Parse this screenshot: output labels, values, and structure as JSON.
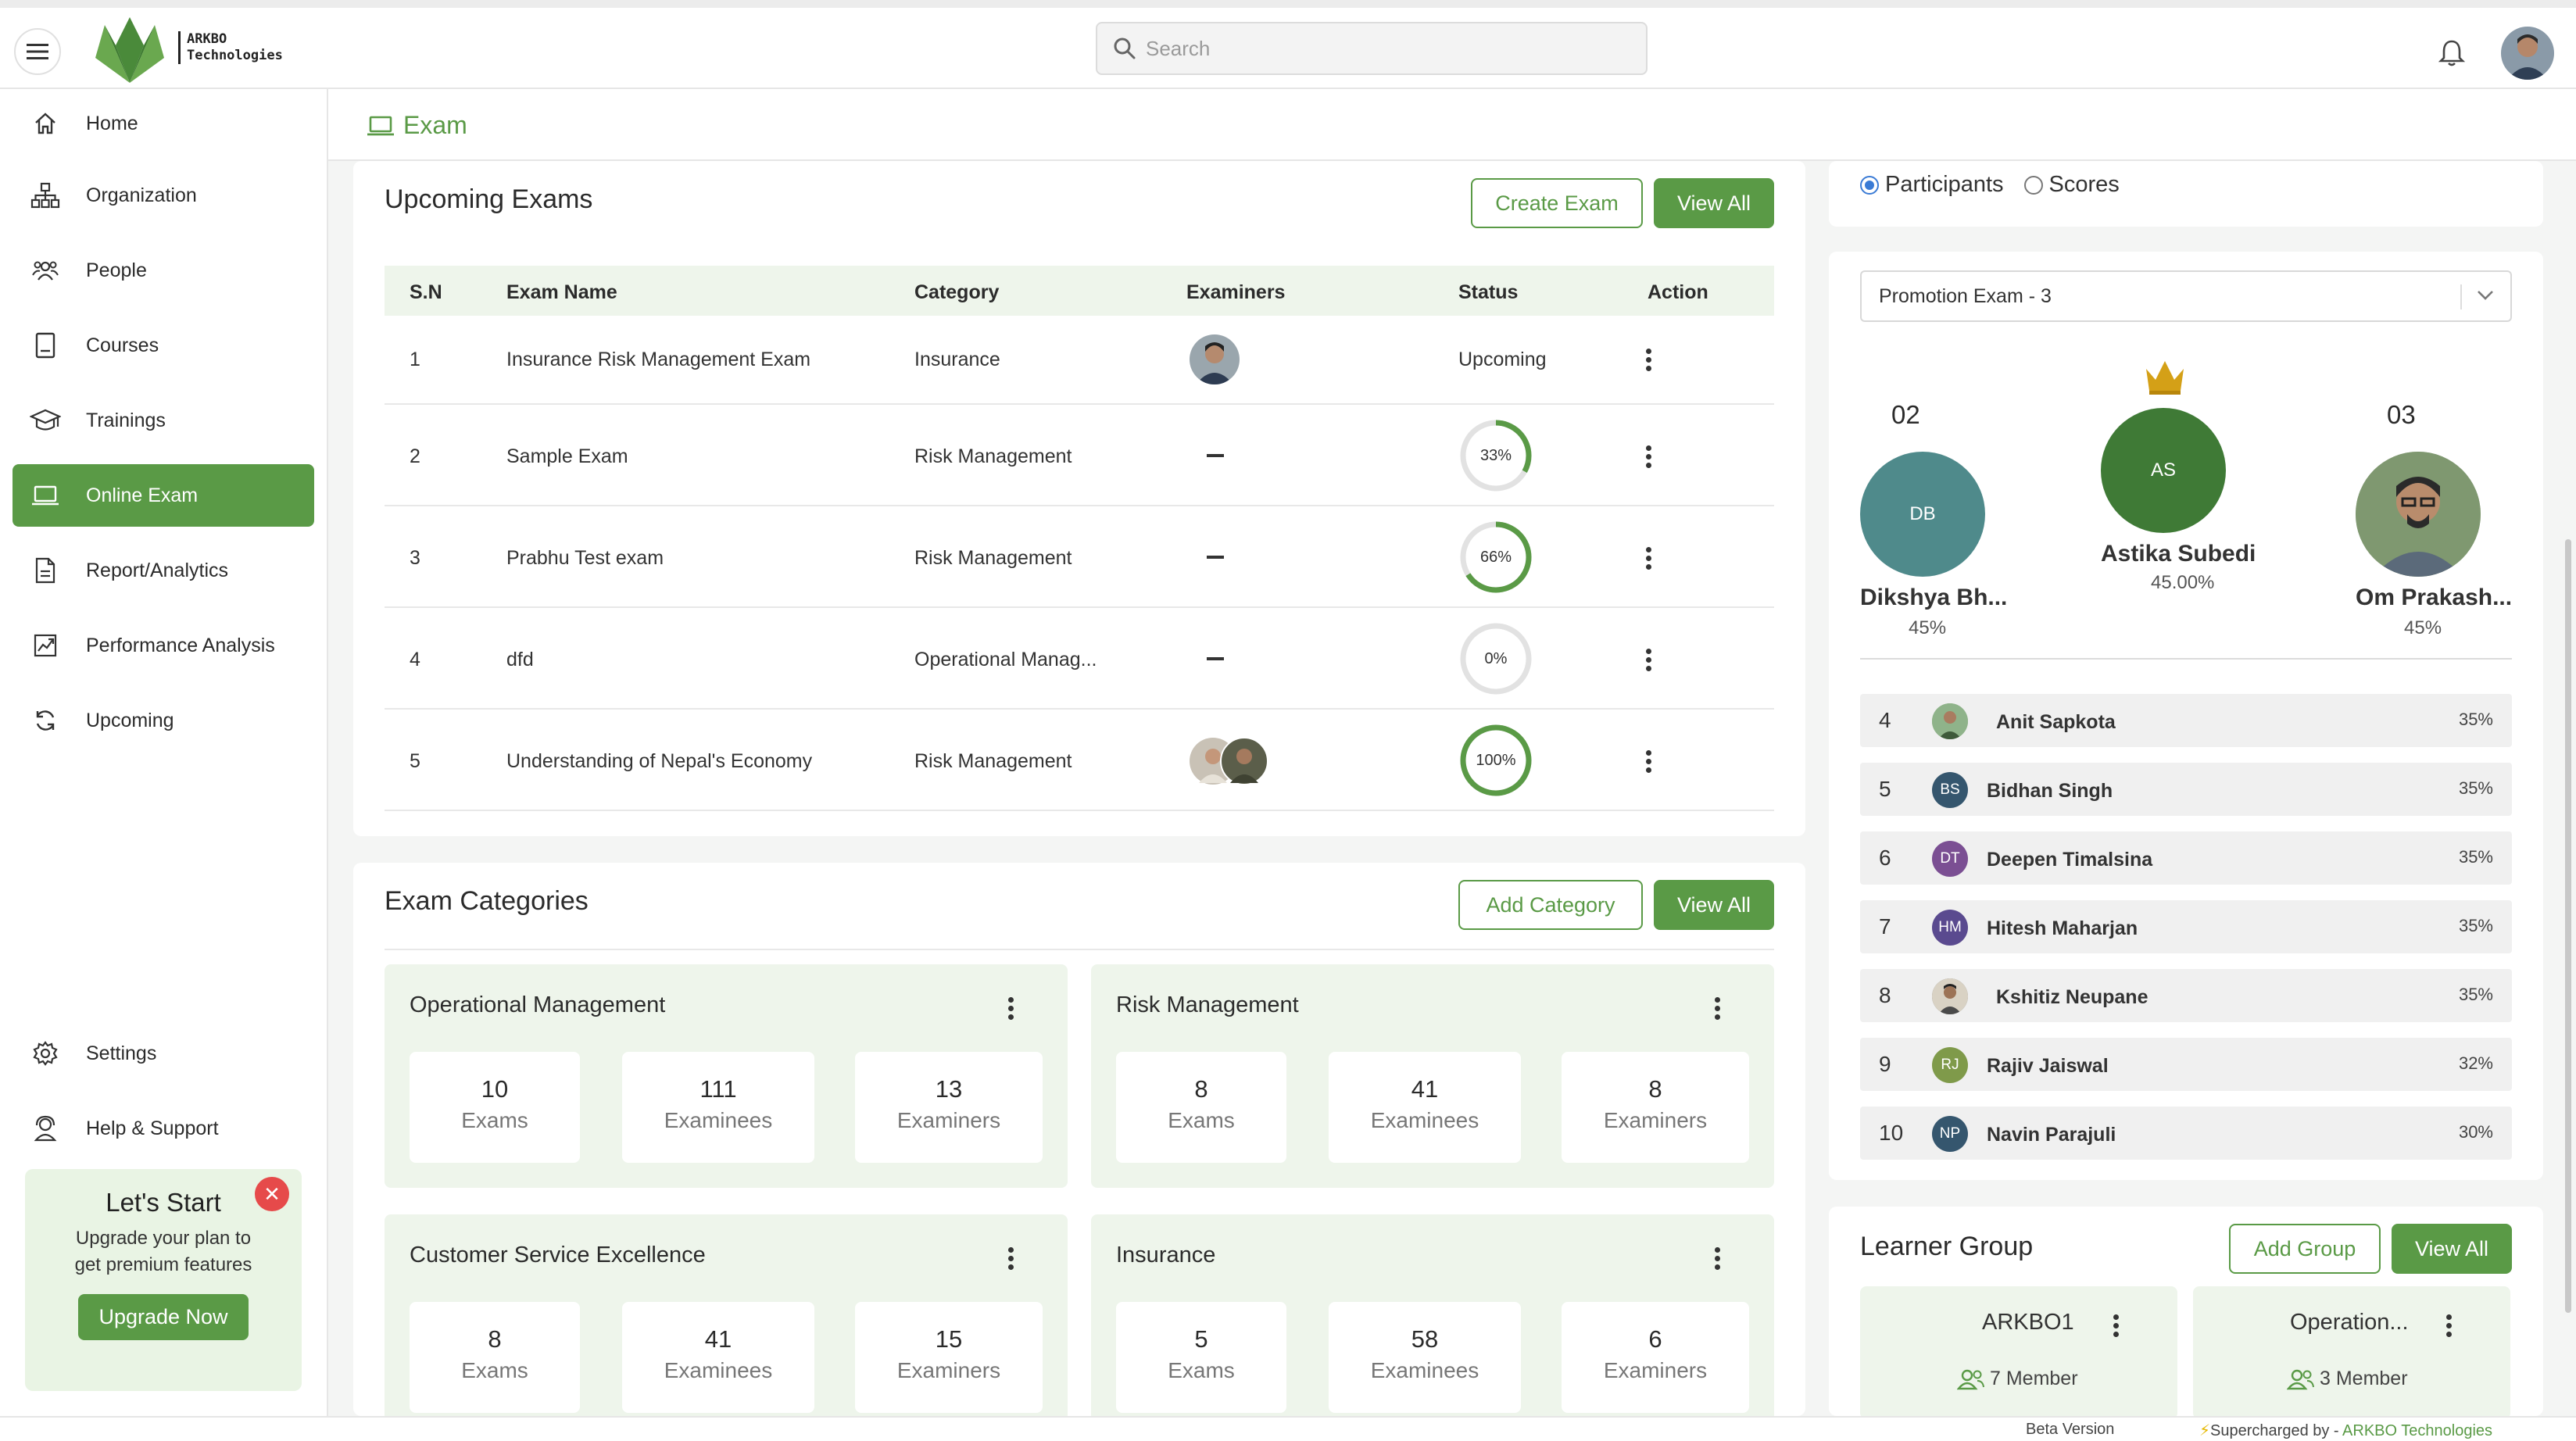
{
  "brand": {
    "logo_text_line1": "ARKBO",
    "logo_text_line2": "Technologies",
    "accent": "#5a9a46"
  },
  "search": {
    "placeholder": "Search"
  },
  "sidebar": {
    "items": [
      {
        "label": "Home",
        "icon": "home-icon"
      },
      {
        "label": "Organization",
        "icon": "org-chart-icon"
      },
      {
        "label": "People",
        "icon": "people-icon"
      },
      {
        "label": "Courses",
        "icon": "book-icon"
      },
      {
        "label": "Trainings",
        "icon": "graduation-cap-icon"
      },
      {
        "label": "Online Exam",
        "icon": "laptop-icon",
        "active": true
      },
      {
        "label": "Report/Analytics",
        "icon": "report-icon"
      },
      {
        "label": "Performance Analysis",
        "icon": "chart-icon"
      },
      {
        "label": "Upcoming",
        "icon": "refresh-icon"
      }
    ],
    "bottom_items": [
      {
        "label": "Settings",
        "icon": "gear-icon"
      },
      {
        "label": "Help & Support",
        "icon": "support-icon"
      }
    ],
    "upgrade": {
      "title": "Let's Start",
      "text_line1": "Upgrade your plan to",
      "text_line2": "get premium features",
      "button": "Upgrade Now"
    }
  },
  "page": {
    "title": "Exam"
  },
  "upcoming": {
    "title": "Upcoming Exams",
    "create_button": "Create Exam",
    "view_all": "View All",
    "columns": [
      "S.N",
      "Exam Name",
      "Category",
      "Examiners",
      "Status",
      "Action"
    ],
    "rows": [
      {
        "sn": "1",
        "name": "Insurance Risk Management Exam",
        "category": "Insurance",
        "examiners": "avatar",
        "status": "Upcoming",
        "progress": null
      },
      {
        "sn": "2",
        "name": "Sample Exam",
        "category": "Risk Management",
        "examiners": "none",
        "status": "33%",
        "progress": 33
      },
      {
        "sn": "3",
        "name": "Prabhu Test exam",
        "category": "Risk Management",
        "examiners": "none",
        "status": "66%",
        "progress": 66
      },
      {
        "sn": "4",
        "name": "dfd",
        "category": "Operational Manag...",
        "examiners": "none",
        "status": "0%",
        "progress": 0
      },
      {
        "sn": "5",
        "name": "Understanding of Nepal's Economy",
        "category": "Risk Management",
        "examiners": "avatars",
        "status": "100%",
        "progress": 100
      }
    ]
  },
  "categories": {
    "title": "Exam Categories",
    "add_button": "Add Category",
    "view_all": "View All",
    "items": [
      {
        "name": "Operational Management",
        "exams": "10",
        "examinees": "111",
        "examiners": "13"
      },
      {
        "name": "Risk Management",
        "exams": "8",
        "examinees": "41",
        "examiners": "8"
      },
      {
        "name": "Customer Service Excellence",
        "exams": "8",
        "examinees": "41",
        "examiners": "15"
      },
      {
        "name": "Insurance",
        "exams": "5",
        "examinees": "58",
        "examiners": "6"
      }
    ],
    "labels": {
      "exams": "Exams",
      "examinees": "Examinees",
      "examiners": "Examiners"
    }
  },
  "leaderboard": {
    "radio_participants": "Participants",
    "radio_scores": "Scores",
    "selected_exam": "Promotion Exam - 3",
    "podium": {
      "first": {
        "initials": "AS",
        "name": "Astika Subedi",
        "pct": "45.00%",
        "color": "#3f7a36"
      },
      "second": {
        "rank": "02",
        "initials": "DB",
        "name": "Dikshya Bh...",
        "pct": "45%",
        "color": "#4f8a8b"
      },
      "third": {
        "rank": "03",
        "name": "Om Prakash...",
        "pct": "45%"
      }
    },
    "rows": [
      {
        "rank": "4",
        "initials": "",
        "photo": true,
        "name": "Anit Sapkota",
        "pct": "35%",
        "color": "#8fb38a"
      },
      {
        "rank": "5",
        "initials": "BS",
        "photo": false,
        "name": "Bidhan Singh",
        "pct": "35%",
        "color": "#35566e"
      },
      {
        "rank": "6",
        "initials": "DT",
        "photo": false,
        "name": "Deepen Timalsina",
        "pct": "35%",
        "color": "#7b4f93"
      },
      {
        "rank": "7",
        "initials": "HM",
        "photo": false,
        "name": "Hitesh Maharjan",
        "pct": "35%",
        "color": "#5a4a8f"
      },
      {
        "rank": "8",
        "initials": "",
        "photo": true,
        "name": "Kshitiz Neupane",
        "pct": "35%",
        "color": "#6b6b6b"
      },
      {
        "rank": "9",
        "initials": "RJ",
        "photo": false,
        "name": "Rajiv Jaiswal",
        "pct": "32%",
        "color": "#7f9a4a"
      },
      {
        "rank": "10",
        "initials": "NP",
        "photo": false,
        "name": "Navin Parajuli",
        "pct": "30%",
        "color": "#35566e"
      }
    ]
  },
  "learner_group": {
    "title": "Learner Group",
    "add_button": "Add Group",
    "view_all": "View All",
    "groups": [
      {
        "name": "ARKBO1",
        "members": "7 Member"
      },
      {
        "name": "Operation...",
        "members": "3 Member"
      }
    ]
  },
  "footer": {
    "beta": "Beta Version",
    "supercharged": "Supercharged by - ",
    "company": "ARKBO Technologies"
  }
}
